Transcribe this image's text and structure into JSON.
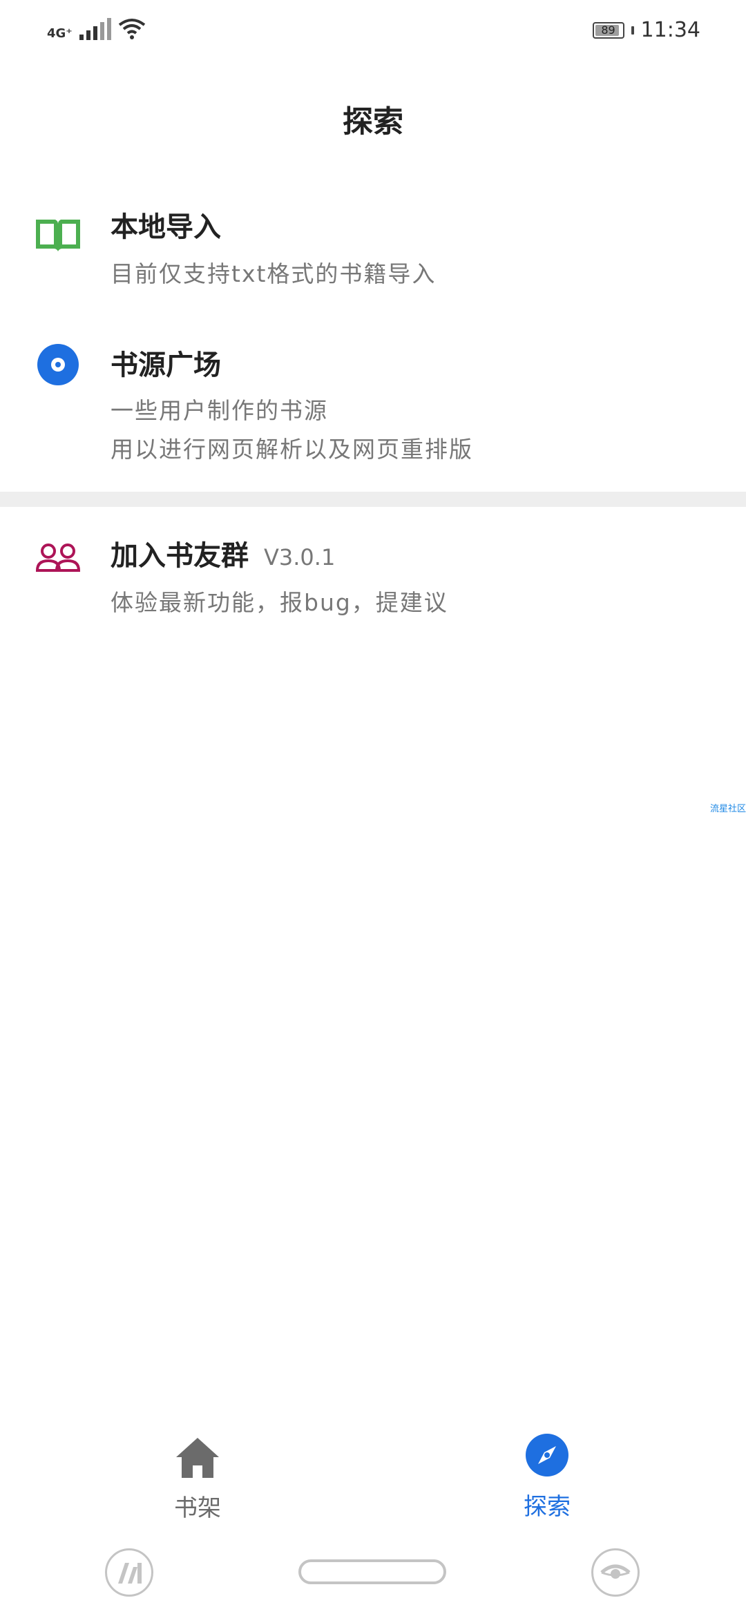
{
  "status_bar": {
    "network": "4G⁺",
    "battery": "89",
    "time": "11:34"
  },
  "header": {
    "title": "探索"
  },
  "items": [
    {
      "title": "本地导入",
      "desc": [
        "目前仅支持txt格式的书籍导入"
      ],
      "icon": "open-book-icon",
      "color": "#4caf50"
    },
    {
      "title": "书源广场",
      "desc": [
        "一些用户制作的书源",
        "用以进行网页解析以及网页重排版"
      ],
      "icon": "record-disc-icon",
      "color": "#1e6fe0"
    },
    {
      "title": "加入书友群",
      "version": "V3.0.1",
      "desc": [
        "体验最新功能，报bug，提建议"
      ],
      "icon": "people-icon",
      "color": "#ad1457"
    }
  ],
  "watermark": "流星社区",
  "bottom_nav": {
    "tabs": [
      {
        "label": "书架",
        "icon": "home-icon",
        "active": false,
        "color": "#6b6b6b"
      },
      {
        "label": "探索",
        "icon": "compass-icon",
        "active": true,
        "color": "#1e6fe0"
      }
    ]
  },
  "system_nav": {
    "left": "app-drawer-icon",
    "center": "home-pill",
    "right": "eye-icon"
  }
}
